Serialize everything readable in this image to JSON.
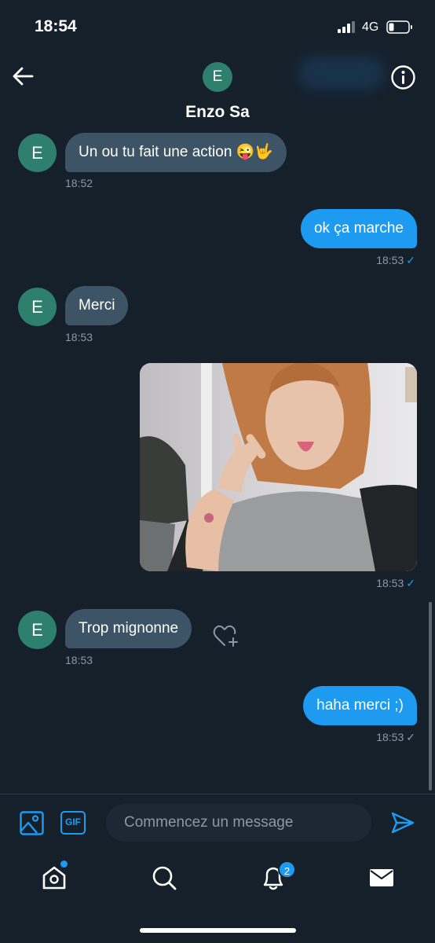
{
  "status_bar": {
    "time": "18:54",
    "network": "4G"
  },
  "header": {
    "contact_name": "Enzo Sa",
    "avatar_initial": "E"
  },
  "messages": [
    {
      "direction": "in",
      "text": "Un ou tu fait une action 😜🤟",
      "time": "18:52"
    },
    {
      "direction": "out",
      "text": "ok ça marche",
      "time": "18:53",
      "status": "✓"
    },
    {
      "direction": "in",
      "text": "Merci",
      "time": "18:53"
    },
    {
      "direction": "out",
      "type": "image",
      "time": "18:53",
      "status": "✓"
    },
    {
      "direction": "in",
      "text": "Trop mignonne",
      "time": "18:53"
    },
    {
      "direction": "out",
      "text": "haha merci ;)",
      "time": "18:53",
      "status": "✓"
    }
  ],
  "composer": {
    "gif_label": "GIF",
    "placeholder": "Commencez un message"
  },
  "tab_bar": {
    "notifications_badge": "2"
  },
  "colors": {
    "background": "#15202b",
    "accent": "#1d9bf0",
    "incoming_bubble": "#3d5466",
    "avatar": "#2f7f6e"
  }
}
